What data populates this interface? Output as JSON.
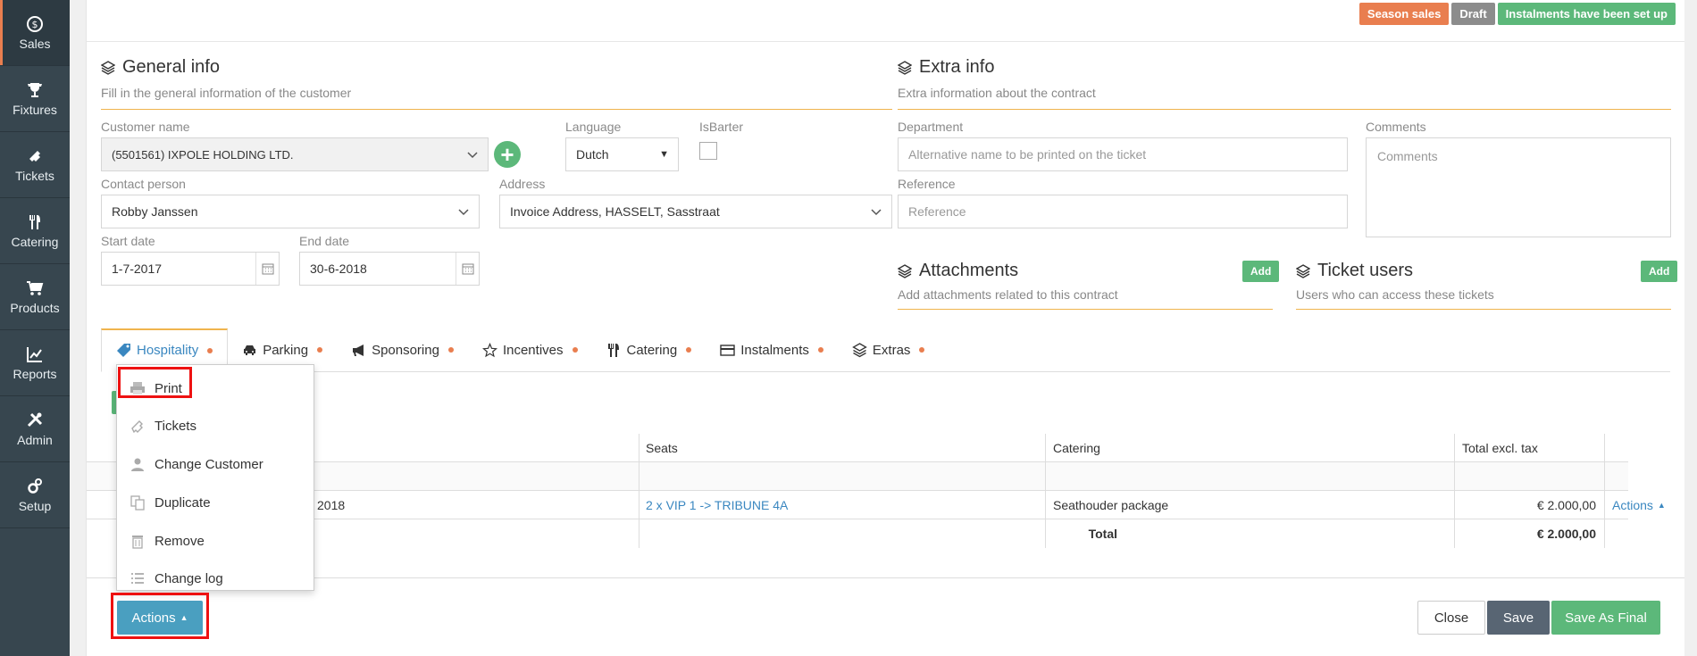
{
  "sidebar": {
    "items": [
      {
        "label": "Sales",
        "icon": "dollar-circle-icon"
      },
      {
        "label": "Fixtures",
        "icon": "trophy-icon"
      },
      {
        "label": "Tickets",
        "icon": "ticket-icon"
      },
      {
        "label": "Catering",
        "icon": "fork-knife-icon"
      },
      {
        "label": "Products",
        "icon": "cart-icon"
      },
      {
        "label": "Reports",
        "icon": "line-chart-icon"
      },
      {
        "label": "Admin",
        "icon": "tools-icon"
      },
      {
        "label": "Setup",
        "icon": "gears-icon"
      }
    ]
  },
  "badges": [
    {
      "label": "Season sales",
      "color": "#e97e4f"
    },
    {
      "label": "Draft",
      "color": "#8c8c8c"
    },
    {
      "label": "Instalments have been set up",
      "color": "#5cb87a"
    }
  ],
  "general_info": {
    "title": "General info",
    "subtitle": "Fill in the general information of the customer",
    "customer_name_label": "Customer name",
    "customer_name_value": "(5501561) IXPOLE HOLDING LTD.",
    "language_label": "Language",
    "language_value": "Dutch",
    "isbarter_label": "IsBarter",
    "contact_label": "Contact person",
    "contact_value": "Robby Janssen",
    "address_label": "Address",
    "address_value": "Invoice Address, HASSELT, Sasstraat",
    "start_label": "Start date",
    "start_value": "1-7-2017",
    "end_label": "End date",
    "end_value": "30-6-2018"
  },
  "extra_info": {
    "title": "Extra info",
    "subtitle": "Extra information about the contract",
    "department_label": "Department",
    "department_placeholder": "Alternative name to be printed on the ticket",
    "comments_label": "Comments",
    "comments_placeholder": "Comments",
    "reference_label": "Reference",
    "reference_placeholder": "Reference"
  },
  "attachments": {
    "title": "Attachments",
    "subtitle": "Add attachments related to this contract",
    "add_label": "Add"
  },
  "ticket_users": {
    "title": "Ticket users",
    "subtitle": "Users who can access these tickets",
    "add_label": "Add"
  },
  "tabs": [
    {
      "label": "Hospitality",
      "icon": "tag-icon"
    },
    {
      "label": "Parking",
      "icon": "car-icon"
    },
    {
      "label": "Sponsoring",
      "icon": "megaphone-icon"
    },
    {
      "label": "Incentives",
      "icon": "star-icon"
    },
    {
      "label": "Catering",
      "icon": "fork-knife-icon"
    },
    {
      "label": "Instalments",
      "icon": "credit-card-icon"
    },
    {
      "label": "Extras",
      "icon": "layers-icon"
    }
  ],
  "table": {
    "headers": {
      "seats": "Seats",
      "catering": "Catering",
      "total": "Total excl. tax"
    },
    "row": {
      "partial": "2018",
      "seats": "2 x VIP 1 -> TRIBUNE 4A",
      "catering": "Seathouder package",
      "total": "€ 2.000,00",
      "actions": "Actions"
    },
    "footer": {
      "label": "Total",
      "value": "€ 2.000,00"
    }
  },
  "menu": {
    "items": [
      {
        "label": "Print",
        "icon": "printer-icon"
      },
      {
        "label": "Tickets",
        "icon": "ticket-icon"
      },
      {
        "label": "Change Customer",
        "icon": "user-icon"
      },
      {
        "label": "Duplicate",
        "icon": "copy-icon"
      },
      {
        "label": "Remove",
        "icon": "trash-icon"
      },
      {
        "label": "Change log",
        "icon": "list-icon"
      }
    ]
  },
  "footer": {
    "actions_label": "Actions",
    "close_label": "Close",
    "save_label": "Save",
    "save_final_label": "Save As Final"
  }
}
